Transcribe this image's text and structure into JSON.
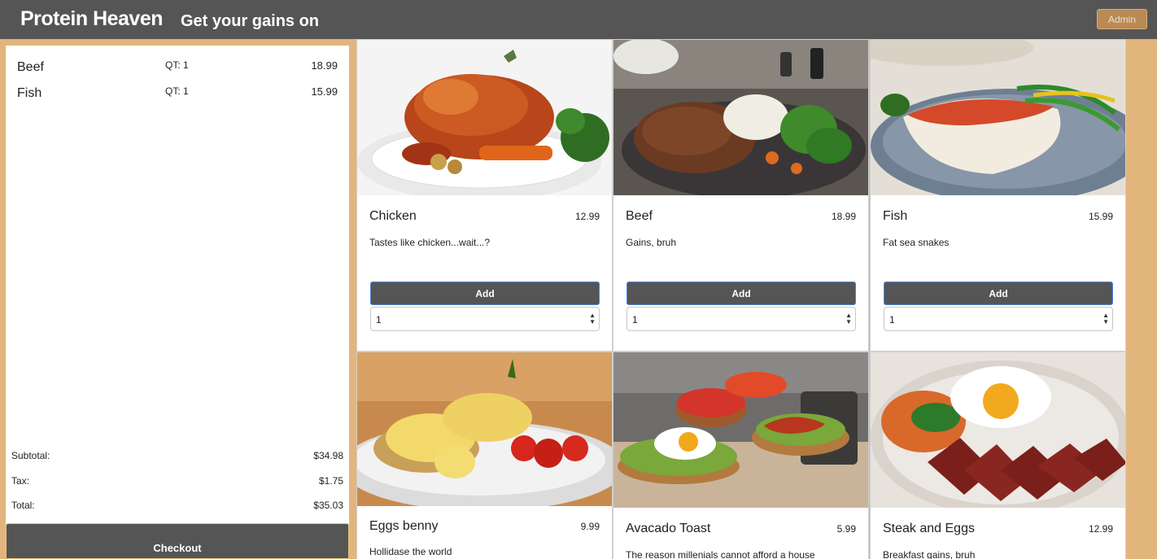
{
  "header": {
    "brand": "Protein Heaven",
    "tagline": "Get your gains on",
    "admin_label": "Admin"
  },
  "cart": {
    "items": [
      {
        "name": "Beef",
        "qty": "QT: 1",
        "price": "18.99"
      },
      {
        "name": "Fish",
        "qty": "QT: 1",
        "price": "15.99"
      }
    ],
    "subtotal_label": "Subtotal:",
    "subtotal": "$34.98",
    "tax_label": "Tax:",
    "tax": "$1.75",
    "total_label": "Total:",
    "total": "$35.03",
    "checkout_label": "Checkout"
  },
  "products": [
    {
      "title": "Chicken",
      "price": "12.99",
      "desc": "Tastes like chicken...wait...?",
      "add_label": "Add",
      "qty": "1"
    },
    {
      "title": "Beef",
      "price": "18.99",
      "desc": "Gains, bruh",
      "add_label": "Add",
      "qty": "1"
    },
    {
      "title": "Fish",
      "price": "15.99",
      "desc": "Fat sea snakes",
      "add_label": "Add",
      "qty": "1"
    },
    {
      "title": "Eggs benny",
      "price": "9.99",
      "desc": "Hollidase the world"
    },
    {
      "title": "Avacado Toast",
      "price": "5.99",
      "desc": "The reason millenials cannot afford a house"
    },
    {
      "title": "Steak and Eggs",
      "price": "12.99",
      "desc": "Breakfast gains, bruh"
    }
  ],
  "colors": {
    "background": "#e2b57c",
    "topbar": "#555555",
    "button": "#555555",
    "admin_button": "#b98a55"
  }
}
